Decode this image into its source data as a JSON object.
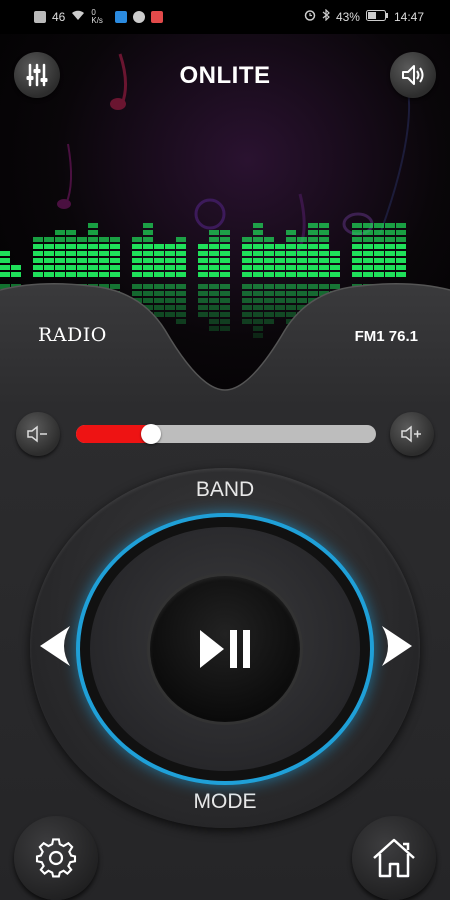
{
  "status_bar": {
    "signal_text": "46",
    "speed_text": "0 K/s",
    "battery": "43%",
    "time": "14:47"
  },
  "header": {
    "title": "ONLITE"
  },
  "source": {
    "label": "RADIO",
    "frequency": "FM1  76.1"
  },
  "volume": {
    "level": 0.25
  },
  "controls": {
    "band_label": "BAND",
    "mode_label": "MODE"
  },
  "colors": {
    "accent_blue": "#1fa0d8",
    "volume_fill": "#ee1313",
    "eq_green": "#1fe05a"
  },
  "icons": {
    "equalizer": "equalizer-icon",
    "speaker": "speaker-icon",
    "volume_down": "volume-down-icon",
    "volume_up": "volume-up-icon",
    "prev": "prev-arrow-icon",
    "next": "next-arrow-icon",
    "play_pause": "play-pause-icon",
    "settings": "gear-icon",
    "home": "home-icon"
  }
}
